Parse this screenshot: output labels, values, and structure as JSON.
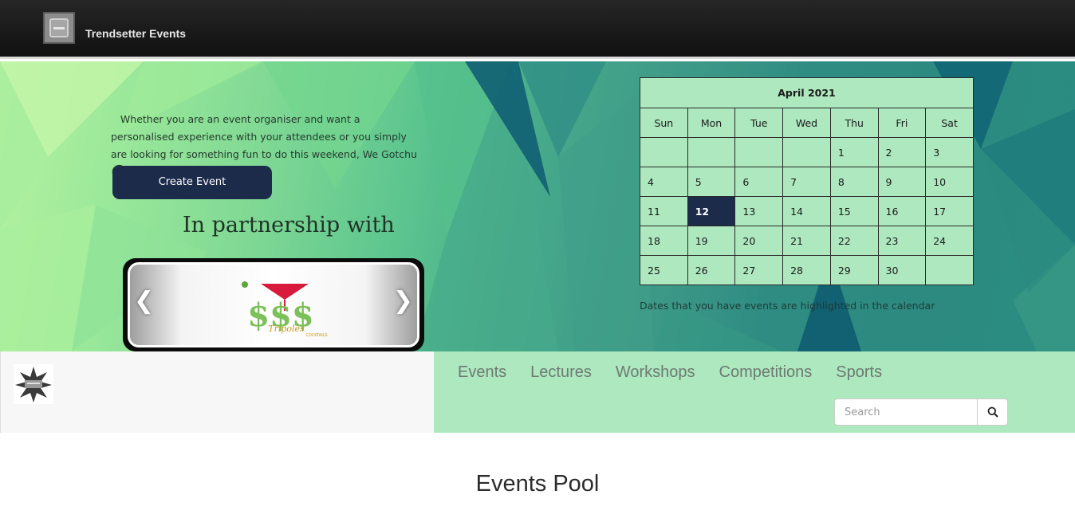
{
  "navbar": {
    "brand_name": "Trendsetter Events",
    "logo_icon": "brand-logo-icon"
  },
  "hero": {
    "tagline": "Whether you are an event organiser and want a personalised experience with your attendees or you simply are looking for something fun to do this weekend, We Gotchu",
    "tagline_emoji": "😆",
    "create_event_label": "Create Event",
    "partnership_heading": "In partnership with",
    "carousel": {
      "prev_icon": "chevron-left-icon",
      "next_icon": "chevron-right-icon",
      "sponsor_logo_text": "$$$",
      "sponsor_logo_subtitle": "Tripoles",
      "sponsor_logo_tagline": "COCKTAILS"
    }
  },
  "calendar": {
    "title": "April 2021",
    "weekdays": [
      "Sun",
      "Mon",
      "Tue",
      "Wed",
      "Thu",
      "Fri",
      "Sat"
    ],
    "weeks": [
      [
        "",
        "",
        "",
        "",
        "1",
        "2",
        "3"
      ],
      [
        "4",
        "5",
        "6",
        "7",
        "8",
        "9",
        "10"
      ],
      [
        "11",
        "12",
        "13",
        "14",
        "15",
        "16",
        "17"
      ],
      [
        "18",
        "19",
        "20",
        "21",
        "22",
        "23",
        "24"
      ],
      [
        "25",
        "26",
        "27",
        "28",
        "29",
        "30",
        ""
      ]
    ],
    "highlighted_day": "12",
    "highlight_color": "#1c2b4a",
    "note": "Dates that you have events are highlighted in the calendar"
  },
  "subnav": {
    "links": [
      "Events",
      "Lectures",
      "Workshops",
      "Competitions",
      "Sports"
    ],
    "search_placeholder": "Search",
    "search_icon": "search-icon"
  },
  "main": {
    "section_title": "Events Pool"
  },
  "colors": {
    "accent": "#1c2b4a",
    "nav_green": "#ade8be"
  }
}
